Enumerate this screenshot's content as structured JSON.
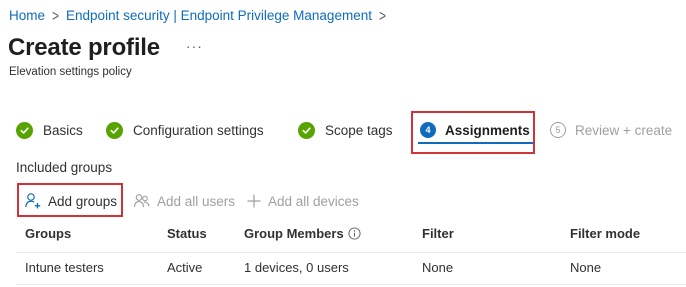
{
  "breadcrumb": {
    "home": "Home",
    "separator": ">",
    "section": "Endpoint security | Endpoint Privilege Management"
  },
  "header": {
    "title": "Create profile",
    "more": "···",
    "subtitle": "Elevation settings policy"
  },
  "wizard": {
    "steps": [
      {
        "label": "Basics",
        "state": "complete",
        "icon": "check-icon"
      },
      {
        "label": "Configuration settings",
        "state": "complete",
        "icon": "check-icon"
      },
      {
        "label": "Scope tags",
        "state": "complete",
        "icon": "check-icon"
      },
      {
        "number": "4",
        "label": "Assignments",
        "state": "current"
      },
      {
        "number": "5",
        "label": "Review + create",
        "state": "upcoming"
      }
    ]
  },
  "assignments": {
    "section_label": "Included groups",
    "commands": {
      "add_groups": "Add groups",
      "add_all_users": "Add all users",
      "add_all_devices": "Add all devices"
    },
    "columns": [
      "Groups",
      "Status",
      "Group Members",
      "Filter",
      "Filter mode"
    ],
    "rows": [
      {
        "group": "Intune testers",
        "status": "Active",
        "members": "1 devices, 0 users",
        "filter": "None",
        "filter_mode": "None"
      }
    ]
  },
  "colors": {
    "accent": "#0f6cbd",
    "complete": "#57a300",
    "highlight": "#d13438",
    "disabled": "#a19f9d"
  }
}
